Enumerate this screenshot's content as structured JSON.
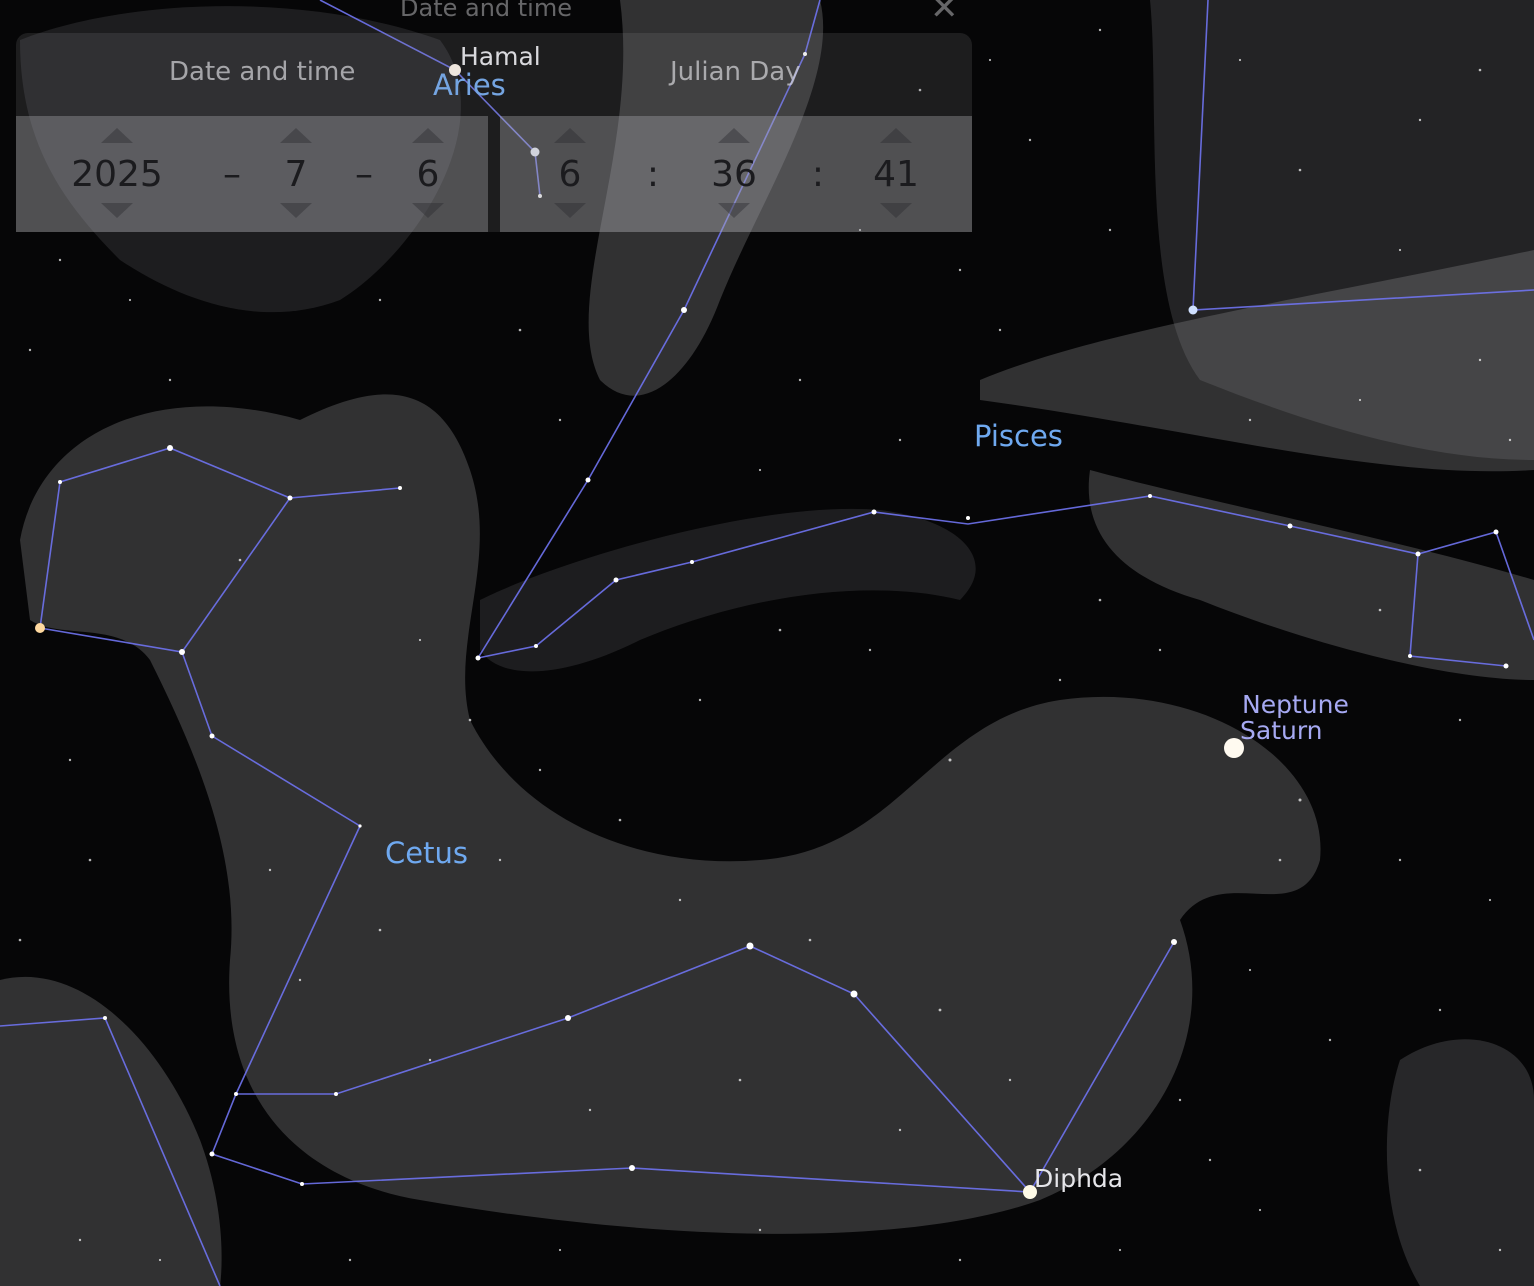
{
  "panel": {
    "title": "Date and time",
    "date_heading": "Date and time",
    "julian_heading": "Julian Day",
    "date_separator": "–",
    "time_separator": ":",
    "date": {
      "year": "2025",
      "month": "7",
      "day": "6"
    },
    "time": {
      "hour": "6",
      "minute": "36",
      "second": "41"
    }
  },
  "sky": {
    "constellations": {
      "aries": "Aries",
      "pisces": "Pisces",
      "cetus": "Cetus"
    },
    "stars": {
      "hamal": "Hamal",
      "diphda": "Diphda"
    },
    "planets": {
      "neptune": "Neptune",
      "saturn": "Saturn"
    },
    "colors": {
      "background": "#060607",
      "constellation_line": "#6f73f0",
      "constellation_label": "#6fa9f0",
      "planet_label": "#a6a9f2",
      "artwork": "#8c8c90"
    }
  }
}
